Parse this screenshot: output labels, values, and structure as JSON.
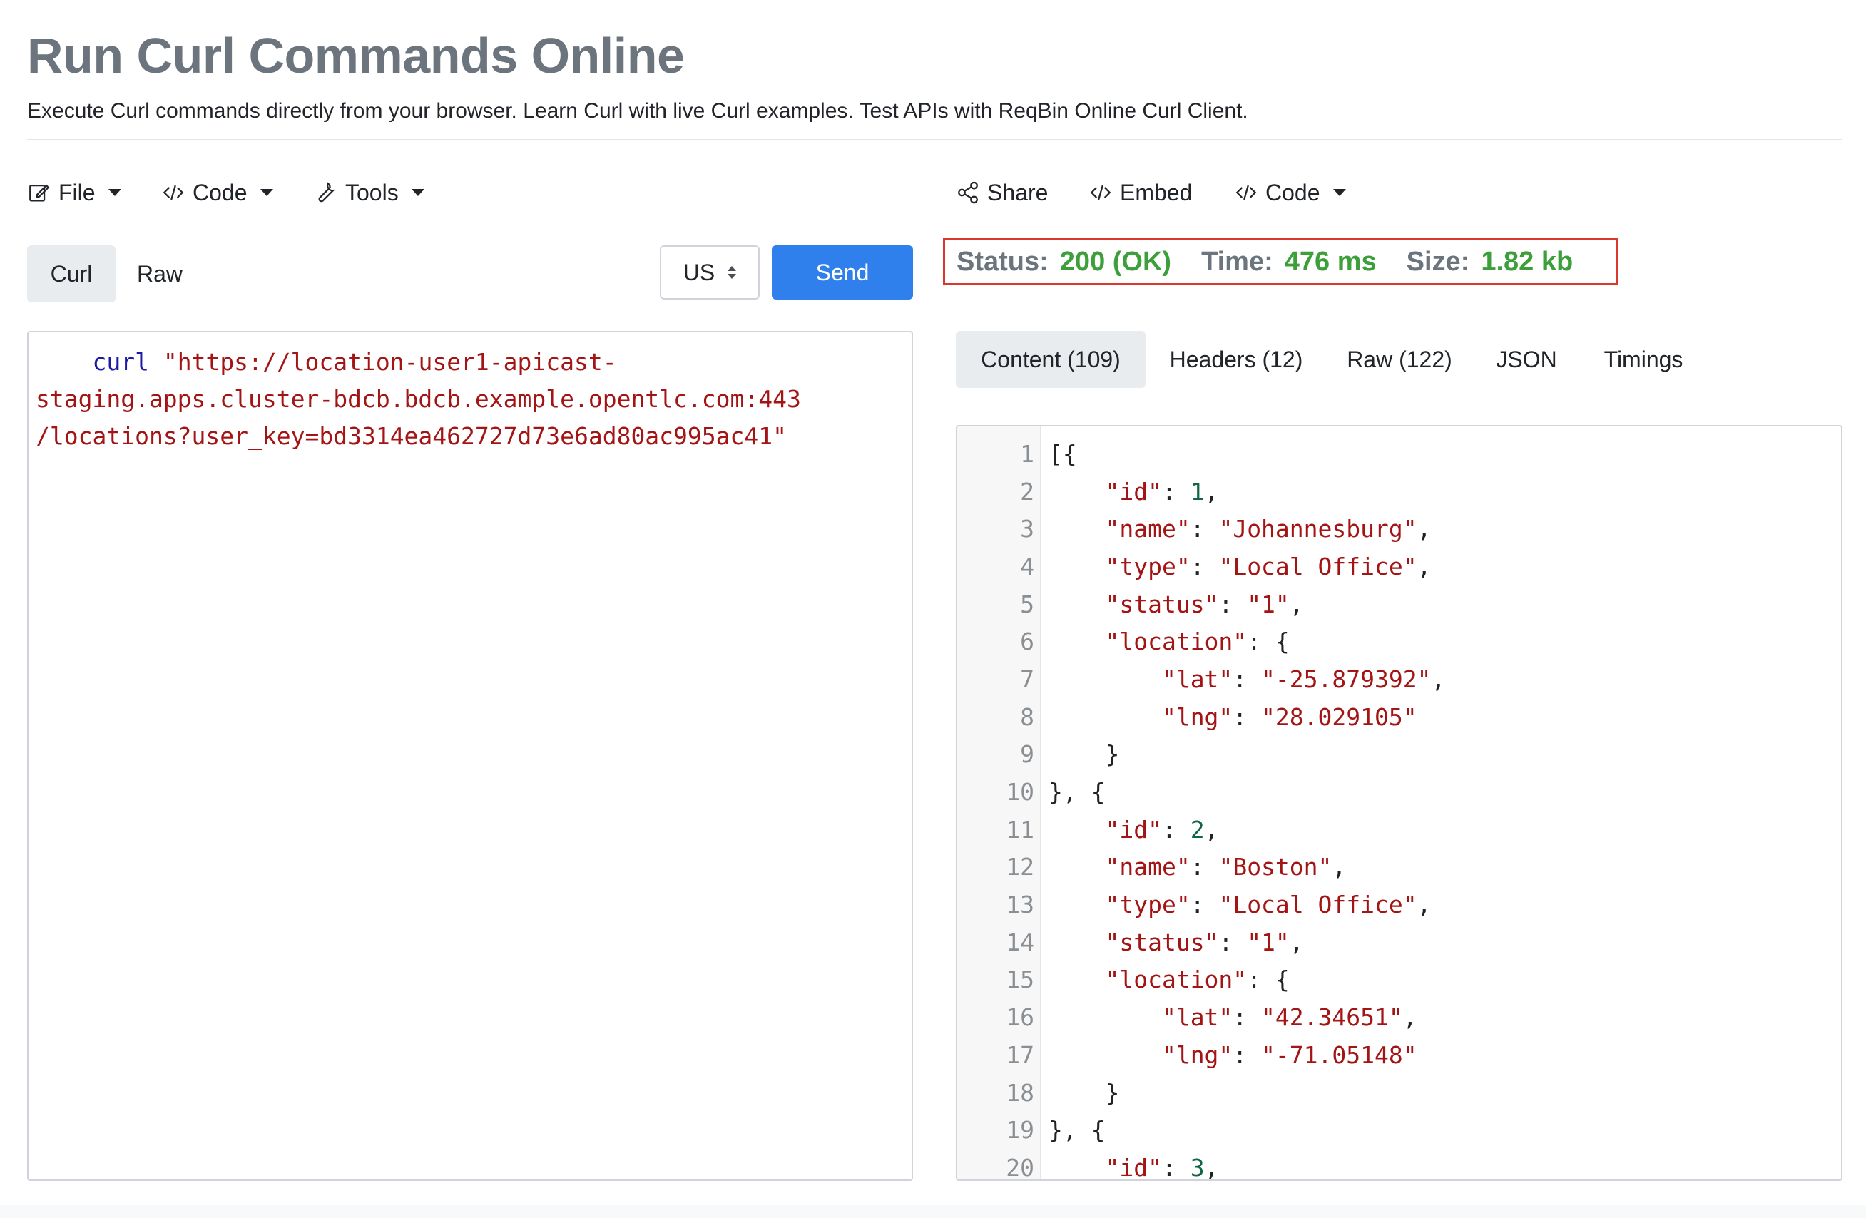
{
  "page": {
    "title": "Run Curl Commands Online",
    "subtitle": "Execute Curl commands directly from your browser. Learn Curl with live Curl examples. Test APIs with ReqBin Online Curl Client."
  },
  "left_menu": {
    "file": "File",
    "code": "Code",
    "tools": "Tools"
  },
  "right_menu": {
    "share": "Share",
    "embed": "Embed",
    "code": "Code"
  },
  "request_tabs": {
    "curl": "Curl",
    "raw": "Raw"
  },
  "region": {
    "selected": "US"
  },
  "send_label": "Send",
  "editor": {
    "command": "curl",
    "url_line1": "\"https://location-user1-apicast-",
    "url_line2": "staging.apps.cluster-bdcb.bdcb.example.opentlc.com:443",
    "url_line3": "/locations?user_key=bd3314ea462727d73e6ad80ac995ac41\""
  },
  "status": {
    "status_label": "Status:",
    "status_value": "200 (OK)",
    "time_label": "Time:",
    "time_value": "476 ms",
    "size_label": "Size:",
    "size_value": "1.82 kb"
  },
  "response_tabs": {
    "content": "Content (109)",
    "headers": "Headers (12)",
    "raw": "Raw (122)",
    "json": "JSON",
    "timings": "Timings"
  },
  "response_lines": [
    {
      "n": "1",
      "indent": "",
      "parts": [
        {
          "t": "p",
          "v": "[{"
        }
      ]
    },
    {
      "n": "2",
      "indent": "    ",
      "parts": [
        {
          "t": "s",
          "v": "\"id\""
        },
        {
          "t": "p",
          "v": ": "
        },
        {
          "t": "n",
          "v": "1"
        },
        {
          "t": "p",
          "v": ","
        }
      ]
    },
    {
      "n": "3",
      "indent": "    ",
      "parts": [
        {
          "t": "s",
          "v": "\"name\""
        },
        {
          "t": "p",
          "v": ": "
        },
        {
          "t": "s",
          "v": "\"Johannesburg\""
        },
        {
          "t": "p",
          "v": ","
        }
      ]
    },
    {
      "n": "4",
      "indent": "    ",
      "parts": [
        {
          "t": "s",
          "v": "\"type\""
        },
        {
          "t": "p",
          "v": ": "
        },
        {
          "t": "s",
          "v": "\"Local Office\""
        },
        {
          "t": "p",
          "v": ","
        }
      ]
    },
    {
      "n": "5",
      "indent": "    ",
      "parts": [
        {
          "t": "s",
          "v": "\"status\""
        },
        {
          "t": "p",
          "v": ": "
        },
        {
          "t": "s",
          "v": "\"1\""
        },
        {
          "t": "p",
          "v": ","
        }
      ]
    },
    {
      "n": "6",
      "indent": "    ",
      "parts": [
        {
          "t": "s",
          "v": "\"location\""
        },
        {
          "t": "p",
          "v": ": {"
        }
      ]
    },
    {
      "n": "7",
      "indent": "        ",
      "parts": [
        {
          "t": "s",
          "v": "\"lat\""
        },
        {
          "t": "p",
          "v": ": "
        },
        {
          "t": "s",
          "v": "\"-25.879392\""
        },
        {
          "t": "p",
          "v": ","
        }
      ]
    },
    {
      "n": "8",
      "indent": "        ",
      "parts": [
        {
          "t": "s",
          "v": "\"lng\""
        },
        {
          "t": "p",
          "v": ": "
        },
        {
          "t": "s",
          "v": "\"28.029105\""
        }
      ]
    },
    {
      "n": "9",
      "indent": "    ",
      "parts": [
        {
          "t": "p",
          "v": "}"
        }
      ]
    },
    {
      "n": "10",
      "indent": "",
      "parts": [
        {
          "t": "p",
          "v": "}, {"
        }
      ]
    },
    {
      "n": "11",
      "indent": "    ",
      "parts": [
        {
          "t": "s",
          "v": "\"id\""
        },
        {
          "t": "p",
          "v": ": "
        },
        {
          "t": "n",
          "v": "2"
        },
        {
          "t": "p",
          "v": ","
        }
      ]
    },
    {
      "n": "12",
      "indent": "    ",
      "parts": [
        {
          "t": "s",
          "v": "\"name\""
        },
        {
          "t": "p",
          "v": ": "
        },
        {
          "t": "s",
          "v": "\"Boston\""
        },
        {
          "t": "p",
          "v": ","
        }
      ]
    },
    {
      "n": "13",
      "indent": "    ",
      "parts": [
        {
          "t": "s",
          "v": "\"type\""
        },
        {
          "t": "p",
          "v": ": "
        },
        {
          "t": "s",
          "v": "\"Local Office\""
        },
        {
          "t": "p",
          "v": ","
        }
      ]
    },
    {
      "n": "14",
      "indent": "    ",
      "parts": [
        {
          "t": "s",
          "v": "\"status\""
        },
        {
          "t": "p",
          "v": ": "
        },
        {
          "t": "s",
          "v": "\"1\""
        },
        {
          "t": "p",
          "v": ","
        }
      ]
    },
    {
      "n": "15",
      "indent": "    ",
      "parts": [
        {
          "t": "s",
          "v": "\"location\""
        },
        {
          "t": "p",
          "v": ": {"
        }
      ]
    },
    {
      "n": "16",
      "indent": "        ",
      "parts": [
        {
          "t": "s",
          "v": "\"lat\""
        },
        {
          "t": "p",
          "v": ": "
        },
        {
          "t": "s",
          "v": "\"42.34651\""
        },
        {
          "t": "p",
          "v": ","
        }
      ]
    },
    {
      "n": "17",
      "indent": "        ",
      "parts": [
        {
          "t": "s",
          "v": "\"lng\""
        },
        {
          "t": "p",
          "v": ": "
        },
        {
          "t": "s",
          "v": "\"-71.05148\""
        }
      ]
    },
    {
      "n": "18",
      "indent": "    ",
      "parts": [
        {
          "t": "p",
          "v": "}"
        }
      ]
    },
    {
      "n": "19",
      "indent": "",
      "parts": [
        {
          "t": "p",
          "v": "}, {"
        }
      ]
    },
    {
      "n": "20",
      "indent": "    ",
      "parts": [
        {
          "t": "s",
          "v": "\"id\""
        },
        {
          "t": "p",
          "v": ": "
        },
        {
          "t": "n",
          "v": "3"
        },
        {
          "t": "p",
          "v": ","
        }
      ]
    }
  ],
  "icons": {
    "file": "edit-icon",
    "code": "code-icon",
    "tools": "wrench-icon",
    "share": "share-icon",
    "embed": "code-icon"
  },
  "colors": {
    "send_button": "#2f80ed",
    "status_ok": "#3c9f3a",
    "highlight_box": "#d9382c",
    "string": "#a31515",
    "number": "#116644",
    "keyword": "#1a1aa6"
  }
}
